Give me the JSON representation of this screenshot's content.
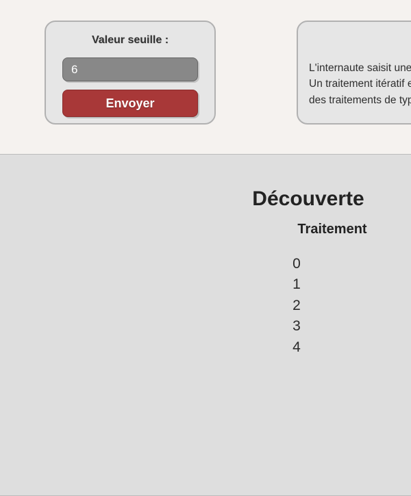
{
  "form": {
    "label": "Valeur seuille :",
    "input_value": "6",
    "submit_label": "Envoyer"
  },
  "description": {
    "line1": "L'internaute saisit une valeur seuil.",
    "line2": "Un traitement itératif est réalisé,",
    "line3": "des traitements de type boucle."
  },
  "main": {
    "title": "Découverte",
    "subtitle": "Traitement",
    "numbers": [
      "0",
      "1",
      "2",
      "3",
      "4"
    ]
  }
}
